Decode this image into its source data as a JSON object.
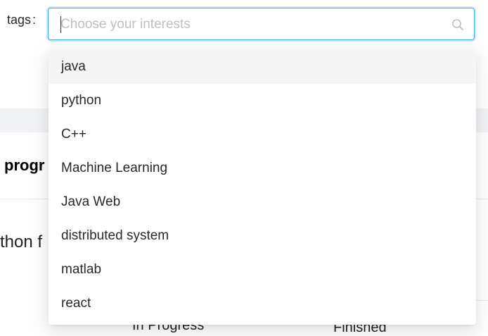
{
  "form": {
    "label": "tags",
    "colon": ":",
    "placeholder": "Choose your interests",
    "value": ""
  },
  "dropdown": {
    "options": [
      {
        "label": "java",
        "active": true
      },
      {
        "label": "python"
      },
      {
        "label": "C++"
      },
      {
        "label": "Machine Learning"
      },
      {
        "label": "Java Web"
      },
      {
        "label": "distributed system"
      },
      {
        "label": "matlab"
      },
      {
        "label": "react"
      }
    ]
  },
  "background": {
    "heading": "progr",
    "course_title": "thon f",
    "status_in_progress": "In Progress",
    "status_finished": "Finished"
  },
  "colors": {
    "focus_border": "#40a9ff",
    "active_option_bg": "#f5f5f5",
    "placeholder": "#bfbfbf"
  }
}
